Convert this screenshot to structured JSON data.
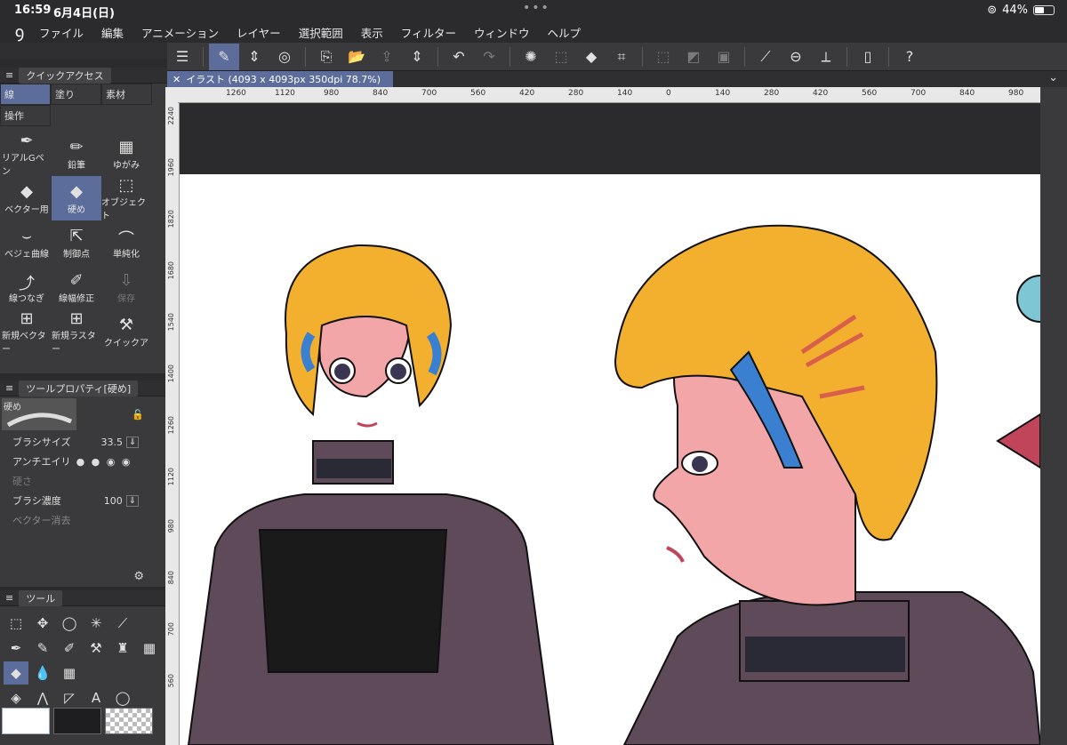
{
  "status": {
    "time": "16:59",
    "date": "6月4日(日)",
    "battery": "44%"
  },
  "menu": [
    "ファイル",
    "編集",
    "アニメーション",
    "レイヤー",
    "選択範囲",
    "表示",
    "フィルター",
    "ウィンドウ",
    "ヘルプ"
  ],
  "quick_access": {
    "title": "クイックアクセス",
    "tabs": [
      {
        "label": "線"
      },
      {
        "label": "塗り"
      },
      {
        "label": "素材"
      },
      {
        "label": "操作"
      }
    ],
    "tools": [
      {
        "label": "リアルGペン",
        "icon": "pen-icon"
      },
      {
        "label": "鉛筆",
        "icon": "pencil-icon"
      },
      {
        "label": "ゆがみ",
        "icon": "liquify-icon"
      },
      {
        "label": "ベクター用",
        "icon": "eraser-icon"
      },
      {
        "label": "硬め",
        "icon": "eraser-icon"
      },
      {
        "label": "オブジェクト",
        "icon": "object-icon"
      },
      {
        "label": "ベジェ曲線",
        "icon": "bezier-icon"
      },
      {
        "label": "制御点",
        "icon": "control-point-icon"
      },
      {
        "label": "単純化",
        "icon": "simplify-icon"
      },
      {
        "label": "線つなぎ",
        "icon": "connect-line-icon"
      },
      {
        "label": "線幅修正",
        "icon": "line-width-icon"
      },
      {
        "label": "保存",
        "icon": "save-icon"
      },
      {
        "label": "新規ベクター",
        "icon": "new-vector-icon"
      },
      {
        "label": "新規ラスター",
        "icon": "new-raster-icon"
      },
      {
        "label": "クイックア",
        "icon": "quick-access-icon"
      }
    ]
  },
  "tool_property": {
    "title": "ツールプロパティ[硬め]",
    "preset": "硬め",
    "brush_size_label": "ブラシサイズ",
    "brush_size": "33.5",
    "antialias_label": "アンチエイリ",
    "hardness_label": "硬さ",
    "density_label": "ブラシ濃度",
    "density": "100",
    "vector_erase_label": "ベクター消去"
  },
  "tool_panel": {
    "title": "ツール"
  },
  "document": {
    "tab_title": "イラスト (4093 x 4093px 350dpi 78.7%)",
    "h_ruler": [
      "1260",
      "1120",
      "980",
      "840",
      "700",
      "560",
      "420",
      "280",
      "140",
      "0",
      "140",
      "280",
      "420",
      "560",
      "700",
      "840",
      "980"
    ],
    "v_ruler": [
      "2240",
      "1960",
      "1820",
      "1680",
      "1540",
      "1400",
      "1260",
      "1120",
      "980",
      "840",
      "700",
      "560"
    ]
  },
  "colors": {
    "accent": "#5c6d9c",
    "hair": "#f3b02f",
    "skin": "#f2a6a8",
    "top": "#5f4a5a"
  }
}
